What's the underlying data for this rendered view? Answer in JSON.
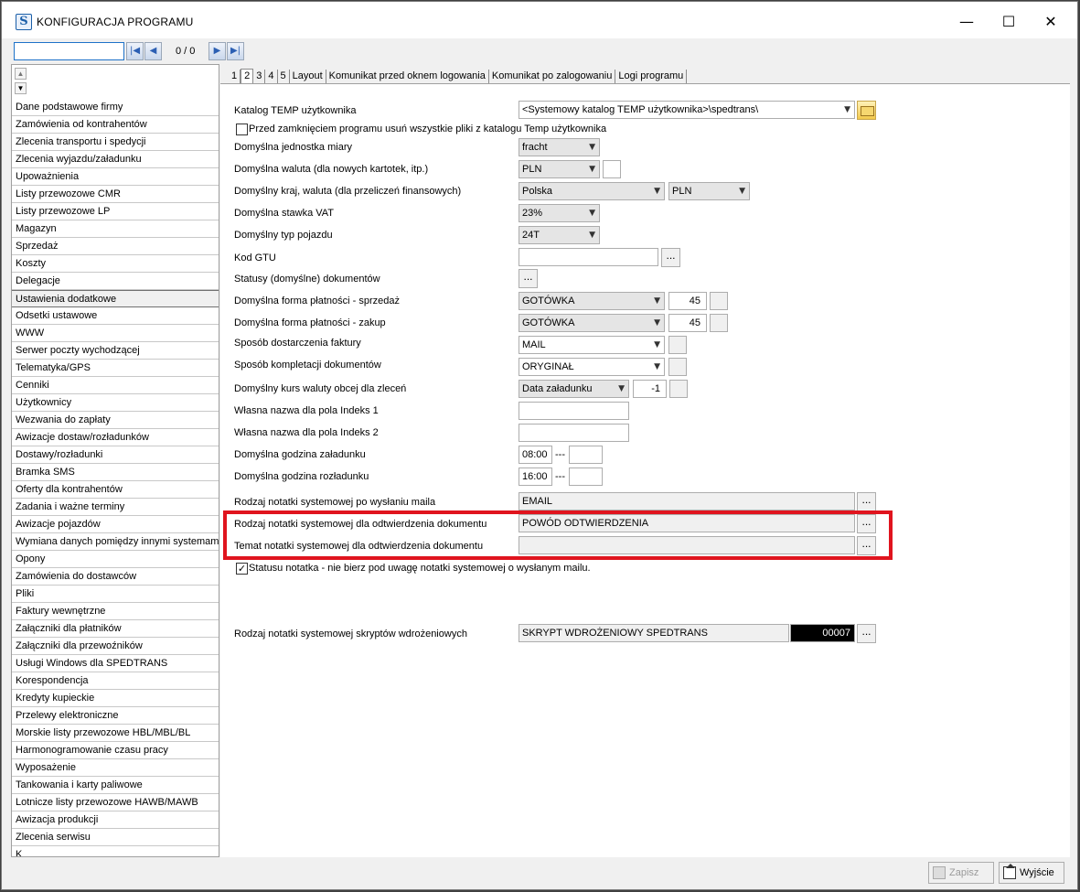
{
  "window": {
    "title": "KONFIGURACJA PROGRAMU",
    "minimize": "—",
    "maximize": "☐",
    "close": "✕"
  },
  "navigator": {
    "search_value": "",
    "count": "0 / 0"
  },
  "sidebar": {
    "items": [
      {
        "label": "Dane podstawowe firmy"
      },
      {
        "label": "Zamówienia od kontrahentów"
      },
      {
        "label": "Zlecenia transportu i spedycji"
      },
      {
        "label": "Zlecenia wyjazdu/załadunku"
      },
      {
        "label": "Upoważnienia"
      },
      {
        "label": "Listy przewozowe CMR"
      },
      {
        "label": "Listy przewozowe LP"
      },
      {
        "label": "Magazyn"
      },
      {
        "label": "Sprzedaż"
      },
      {
        "label": "Koszty"
      },
      {
        "label": "Delegacje"
      },
      {
        "label": "Ustawienia dodatkowe"
      },
      {
        "label": "Odsetki ustawowe"
      },
      {
        "label": "WWW"
      },
      {
        "label": "Serwer poczty wychodzącej"
      },
      {
        "label": "Telematyka/GPS"
      },
      {
        "label": "Cenniki"
      },
      {
        "label": "Użytkownicy"
      },
      {
        "label": "Wezwania do zapłaty"
      },
      {
        "label": "Awizacje dostaw/rozładunków"
      },
      {
        "label": "Dostawy/rozładunki"
      },
      {
        "label": "Bramka SMS"
      },
      {
        "label": "Oferty dla kontrahentów"
      },
      {
        "label": "Zadania i ważne terminy"
      },
      {
        "label": "Awizacje pojazdów"
      },
      {
        "label": "Wymiana danych pomiędzy innymi systemami"
      },
      {
        "label": "Opony"
      },
      {
        "label": "Zamówienia do dostawców"
      },
      {
        "label": "Pliki"
      },
      {
        "label": "Faktury wewnętrzne"
      },
      {
        "label": "Załączniki dla płatników"
      },
      {
        "label": "Załączniki dla przewoźników"
      },
      {
        "label": "Usługi Windows dla SPEDTRANS"
      },
      {
        "label": "Korespondencja"
      },
      {
        "label": "Kredyty kupieckie"
      },
      {
        "label": "Przelewy elektroniczne"
      },
      {
        "label": "Morskie listy przewozowe HBL/MBL/BL"
      },
      {
        "label": "Harmonogramowanie czasu pracy"
      },
      {
        "label": "Wyposażenie"
      },
      {
        "label": "Tankowania i karty paliwowe"
      },
      {
        "label": "Lotnicze listy przewozowe HAWB/MAWB"
      },
      {
        "label": "Awizacja produkcji"
      },
      {
        "label": "Zlecenia serwisu"
      },
      {
        "label": "K"
      }
    ],
    "selected_index": 11
  },
  "tabs": [
    {
      "label": "1"
    },
    {
      "label": "2"
    },
    {
      "label": "3"
    },
    {
      "label": "4"
    },
    {
      "label": "5"
    },
    {
      "label": "Layout"
    },
    {
      "label": "Komunikat przed oknem logowania"
    },
    {
      "label": "Komunikat po zalogowaniu"
    },
    {
      "label": "Logi programu"
    }
  ],
  "form": {
    "temp_dir_label": "Katalog TEMP użytkownika",
    "temp_dir_value": "<Systemowy katalog TEMP użytkownika>\\spedtrans\\",
    "clear_temp_label": "Przed zamknięciem programu usuń wszystkie pliki z katalogu Temp użytkownika",
    "unit_label": "Domyślna jednostka miary",
    "unit_value": "fracht",
    "currency_label": "Domyślna waluta (dla nowych kartotek, itp.)",
    "currency_value": "PLN",
    "country_label": "Domyślny kraj, waluta (dla przeliczeń finansowych)",
    "country_value": "Polska",
    "country_currency_value": "PLN",
    "vat_label": "Domyślna stawka VAT",
    "vat_value": "23%",
    "vehicle_label": "Domyślny typ pojazdu",
    "vehicle_value": "24T",
    "gtu_label": "Kod GTU",
    "gtu_value": "",
    "statuses_label": "Statusy (domyślne) dokumentów",
    "pay_sale_label": "Domyślna forma płatności - sprzedaż",
    "pay_sale_value": "GOTÓWKA",
    "pay_sale_days": "45",
    "pay_buy_label": "Domyślna forma płatności - zakup",
    "pay_buy_value": "GOTÓWKA",
    "pay_buy_days": "45",
    "invoice_delivery_label": "Sposób dostarczenia faktury",
    "invoice_delivery_value": "MAIL",
    "doc_completion_label": "Sposób kompletacji dokumentów",
    "doc_completion_value": "ORYGINAŁ",
    "fx_rate_label": "Domyślny kurs waluty obcej dla zleceń",
    "fx_rate_value": "Data załadunku",
    "fx_rate_offset": "-1",
    "index1_label": "Własna nazwa dla pola Indeks 1",
    "index1_value": "",
    "index2_label": "Własna nazwa dla pola Indeks 2",
    "index2_value": "",
    "load_hour_label": "Domyślna godzina załadunku",
    "load_hour_value": "08:00",
    "unload_hour_label": "Domyślna godzina rozładunku",
    "unload_hour_value": "16:00",
    "hour_sep": "---",
    "note_mail_label": "Rodzaj notatki systemowej po wysłaniu maila",
    "note_mail_value": "EMAIL",
    "note_reconfirm_label": "Rodzaj notatki systemowej dla odtwierdzenia dokumentu",
    "note_reconfirm_value": "POWÓD ODTWIERDZENIA",
    "note_subject_label": "Temat notatki systemowej dla odtwierdzenia dokumentu",
    "note_subject_value": "",
    "status_note_label": "Statusu notatka - nie bierz pod uwagę notatki systemowej o wysłanym mailu.",
    "status_note_checked": true,
    "script_note_label": "Rodzaj notatki systemowej skryptów wdrożeniowych",
    "script_note_value": "SKRYPT WDROŻENIOWY SPEDTRANS",
    "script_note_code": "00007",
    "dots": "..."
  },
  "buttons": {
    "save": "Zapisz",
    "exit": "Wyjście"
  },
  "colors": {
    "highlight": "#e0141e",
    "nav_accent": "#2c5fb3"
  }
}
